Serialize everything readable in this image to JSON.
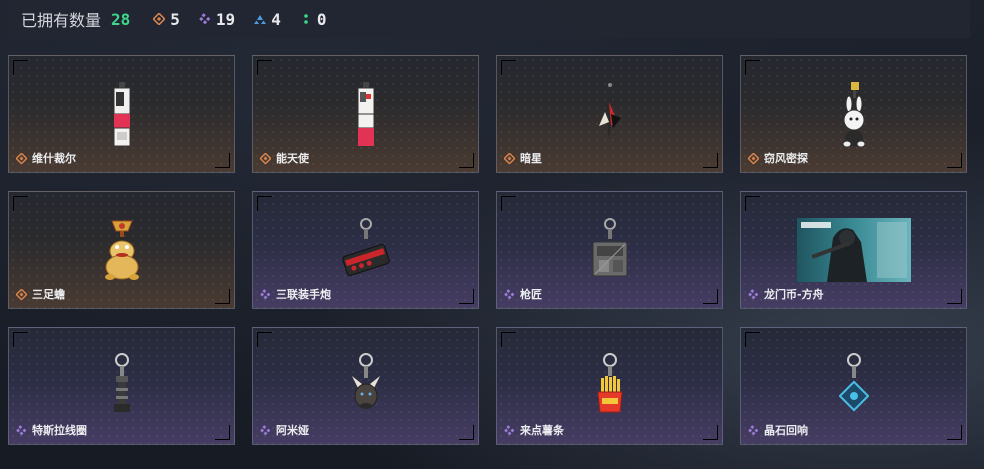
{
  "header": {
    "title": "已拥有数量",
    "total": "28",
    "stats": [
      {
        "icon": "orange-diamond-icon",
        "value": "5",
        "color": "#d8834b"
      },
      {
        "icon": "purple-diamond-icon",
        "value": "19",
        "color": "#9b7bd9"
      },
      {
        "icon": "blue-triangle-icon",
        "value": "4",
        "color": "#4d9be0"
      },
      {
        "icon": "green-dots-icon",
        "value": "0",
        "color": "#3ed68a"
      }
    ]
  },
  "items": [
    {
      "name": "维什裁尔",
      "rarity": "orange",
      "icon": "vape-pendant-icon"
    },
    {
      "name": "能天使",
      "rarity": "orange",
      "icon": "vape-pendant-icon"
    },
    {
      "name": "暗星",
      "rarity": "orange",
      "icon": "dagger-pendant-icon"
    },
    {
      "name": "窃风密探",
      "rarity": "orange",
      "icon": "rabbit-figure-icon"
    },
    {
      "name": "三足蟾",
      "rarity": "orange",
      "icon": "toad-figure-icon"
    },
    {
      "name": "三联装手炮",
      "rarity": "purple",
      "icon": "hand-cannon-icon"
    },
    {
      "name": "枪匠",
      "rarity": "purple",
      "icon": "gunsmith-tag-icon"
    },
    {
      "name": "龙门币-方舟",
      "rarity": "purple",
      "icon": "arknights-coin-icon"
    },
    {
      "name": "特斯拉线圈",
      "rarity": "purple",
      "icon": "tesla-coil-keychain-icon"
    },
    {
      "name": "阿米娅",
      "rarity": "purple",
      "icon": "amiya-keychain-icon"
    },
    {
      "name": "来点薯条",
      "rarity": "purple",
      "icon": "fries-keychain-icon"
    },
    {
      "name": "晶石回响",
      "rarity": "purple",
      "icon": "crystal-keychain-icon"
    }
  ],
  "colors": {
    "orange_rarity": "#d8834b",
    "purple_rarity": "#9b7bd9",
    "total_accent": "#3ed68a"
  }
}
